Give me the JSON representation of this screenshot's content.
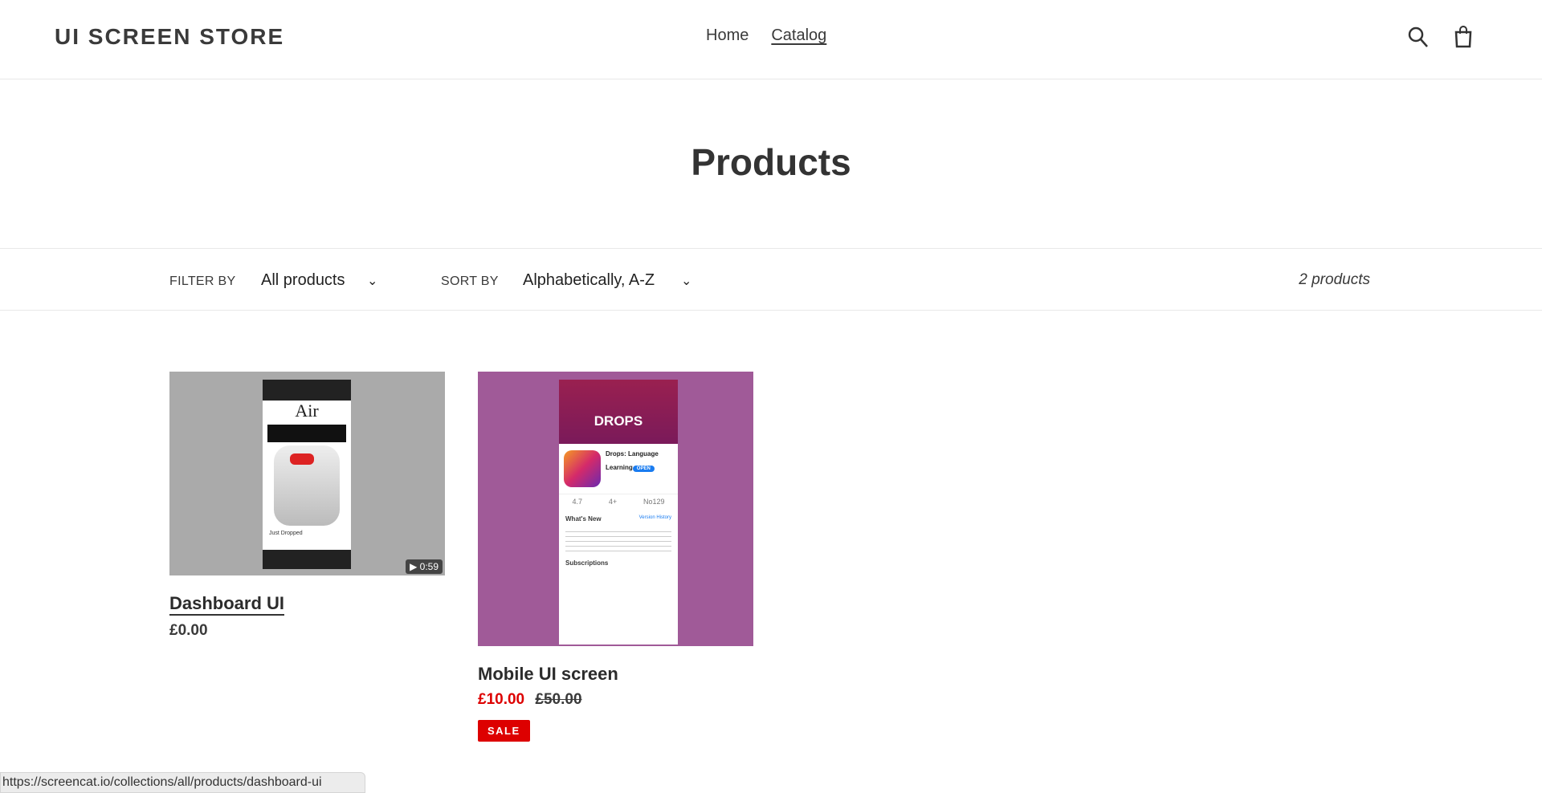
{
  "header": {
    "logo": "UI SCREEN STORE",
    "nav": [
      {
        "label": "Home"
      },
      {
        "label": "Catalog",
        "active": true
      }
    ],
    "icons": [
      "search-icon",
      "cart-icon"
    ]
  },
  "page": {
    "title": "Products"
  },
  "filters": {
    "filter_label": "FILTER BY",
    "filter_value": "All products",
    "sort_label": "SORT BY",
    "sort_value": "Alphabetically, A-Z",
    "count": "2 products"
  },
  "products": [
    {
      "title": "Dashboard UI",
      "price": "£0.00",
      "video_duration": "0:59",
      "image_bg": "#aaaaaa",
      "screen_text": [
        "Air",
        "Just Dropped"
      ]
    },
    {
      "title": "Mobile UI screen",
      "price": "£10.00",
      "compare_price": "£50.00",
      "badge": "SALE",
      "image_bg": "#a05a98",
      "screen_text": [
        "DROPS",
        "Drops: Language Learning",
        "OPEN",
        "4.7",
        "4+",
        "No129",
        "What's New",
        "Version History",
        "Subscriptions"
      ]
    }
  ],
  "colors": {
    "sale": "#d00000",
    "text": "#3a3a3a"
  },
  "status_bar": {
    "url": "https://screencat.io/collections/all/products/dashboard-ui"
  }
}
